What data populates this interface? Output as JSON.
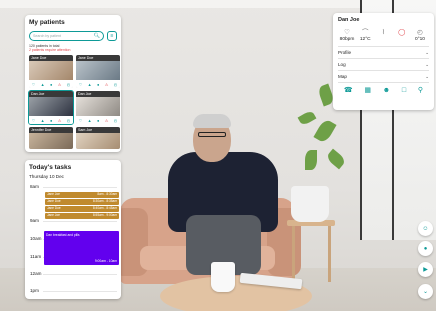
{
  "patients_panel": {
    "title": "My patients",
    "search_placeholder": "Search by patient",
    "count_text": "120 patients in total",
    "attention_text": "2 patients require attention",
    "tiles": [
      {
        "name": "Jane Doe",
        "active": false
      },
      {
        "name": "Jane Doe",
        "active": false
      },
      {
        "name": "Dan Joe",
        "active": true
      },
      {
        "name": "Dan Joe",
        "active": false
      },
      {
        "name": "Jennifer Doe",
        "active": false
      },
      {
        "name": "Sam Joe",
        "active": false
      }
    ]
  },
  "tasks_panel": {
    "title": "Today's tasks",
    "date": "Thursday 10 Dec",
    "hours": [
      "8am",
      "9am",
      "10am",
      "11am",
      "12am",
      "1pm"
    ],
    "small_tasks": [
      {
        "label": "Jane Joe",
        "time": "8am - 8:30am"
      },
      {
        "label": "Jane Doe",
        "time": "8:30am - 8:35am"
      },
      {
        "label": "Jane Doe",
        "time": "8:40am - 8:45am"
      },
      {
        "label": "Jane Joe",
        "time": "8:55am - 9:00am"
      }
    ],
    "big_task": {
      "label": "Dan breakfast and pills",
      "time": "9:00am - 10am"
    },
    "colors": {
      "small": "#c08a2e",
      "big": "#6200ee"
    }
  },
  "detail_panel": {
    "title": "Dan Joe",
    "vitals": [
      {
        "icon": "heart-icon",
        "value": "80bpm",
        "warn": false
      },
      {
        "icon": "thermometer-icon",
        "value": "12°C",
        "warn": false
      },
      {
        "icon": "drop-icon",
        "value": "",
        "warn": false
      },
      {
        "icon": "shield-alert-icon",
        "value": "",
        "warn": true
      },
      {
        "icon": "clock-icon",
        "value": "0°10",
        "warn": false
      }
    ],
    "sections": [
      "Profile",
      "Log",
      "Map"
    ],
    "actions": [
      "phone-icon",
      "map-icon",
      "person-icon",
      "document-icon",
      "search-icon"
    ]
  },
  "floating_buttons": [
    "people-icon",
    "microphone-icon",
    "volume-icon",
    "chevron-down-icon"
  ],
  "colors": {
    "accent": "#0e9a97",
    "alert": "#e0464c"
  }
}
